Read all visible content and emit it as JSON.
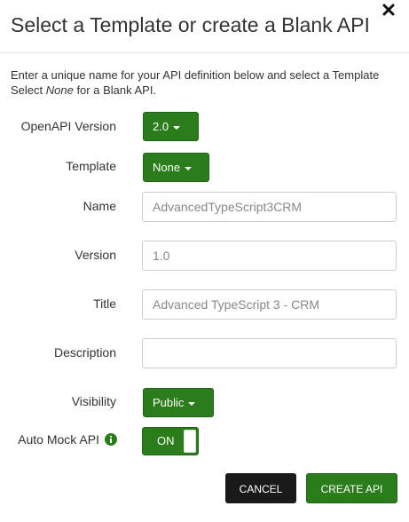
{
  "dialog": {
    "title": "Select a Template or create a Blank API",
    "close_icon": "close-icon",
    "intro_line1": "Enter a unique name for your API definition below and select a Template",
    "intro_line2_prefix": "Select ",
    "intro_line2_emphasis": "None",
    "intro_line2_suffix": " for a Blank API."
  },
  "form": {
    "openapi_version": {
      "label": "OpenAPI Version",
      "value": "2.0"
    },
    "template": {
      "label": "Template",
      "value": "None"
    },
    "name": {
      "label": "Name",
      "value": "",
      "placeholder": "AdvancedTypeScript3CRM"
    },
    "version": {
      "label": "Version",
      "value": "",
      "placeholder": "1.0"
    },
    "title": {
      "label": "Title",
      "value": "",
      "placeholder": "Advanced TypeScript 3 - CRM"
    },
    "description": {
      "label": "Description",
      "value": "",
      "placeholder": ""
    },
    "visibility": {
      "label": "Visibility",
      "value": "Public"
    },
    "auto_mock": {
      "label": "Auto Mock API",
      "state": "ON",
      "info_icon": "info-circle-icon"
    }
  },
  "actions": {
    "cancel_label": "CANCEL",
    "create_label": "CREATE API"
  },
  "colors": {
    "primary_green": "#2a7d1a",
    "cancel_dark": "#1a1a1a"
  }
}
